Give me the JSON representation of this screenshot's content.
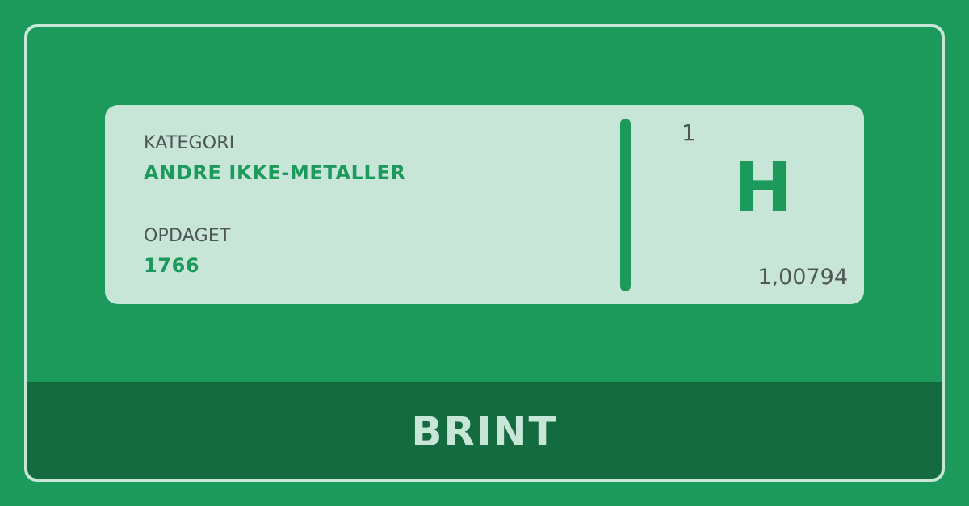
{
  "info": {
    "category_label": "KATEGORI",
    "category_value": "ANDRE IKKE-METALLER",
    "discovered_label": "OPDAGET",
    "discovered_value": "1766"
  },
  "element": {
    "atomic_number": "1",
    "symbol": "H",
    "atomic_mass": "1,00794",
    "name": "BRINT"
  },
  "colors": {
    "background": "#1b9a5b",
    "card": "#c8e6d8",
    "band": "#156b40",
    "text_gray": "#4f5656"
  }
}
